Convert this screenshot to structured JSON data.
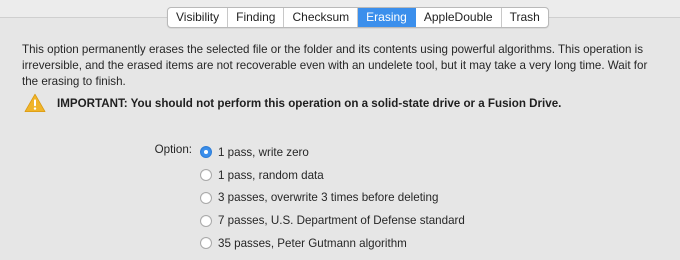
{
  "tabs": [
    {
      "label": "Visibility",
      "active": false
    },
    {
      "label": "Finding",
      "active": false
    },
    {
      "label": "Checksum",
      "active": false
    },
    {
      "label": "Erasing",
      "active": true
    },
    {
      "label": "AppleDouble",
      "active": false
    },
    {
      "label": "Trash",
      "active": false
    }
  ],
  "erasing": {
    "description": "This option permanently erases the selected file or the folder and its contents using powerful algorithms. This operation is irreversible, and the erased items are not recoverable even with an undelete tool, but it may take a very long time. Wait for the erasing to finish.",
    "warning_icon": "warning-triangle-icon",
    "warning": "IMPORTANT: You should not perform this operation on a solid-state drive or a Fusion Drive.",
    "option_label": "Option:",
    "options": [
      {
        "label": "1 pass, write zero",
        "selected": true
      },
      {
        "label": "1 pass, random data",
        "selected": false
      },
      {
        "label": "3 passes, overwrite 3 times before deleting",
        "selected": false
      },
      {
        "label": "7 passes, U.S. Department of Defense standard",
        "selected": false
      },
      {
        "label": "35 passes, Peter Gutmann algorithm",
        "selected": false
      }
    ]
  },
  "colors": {
    "accent": "#3b8fec",
    "background": "#ececec",
    "warning": "#f0b429"
  }
}
